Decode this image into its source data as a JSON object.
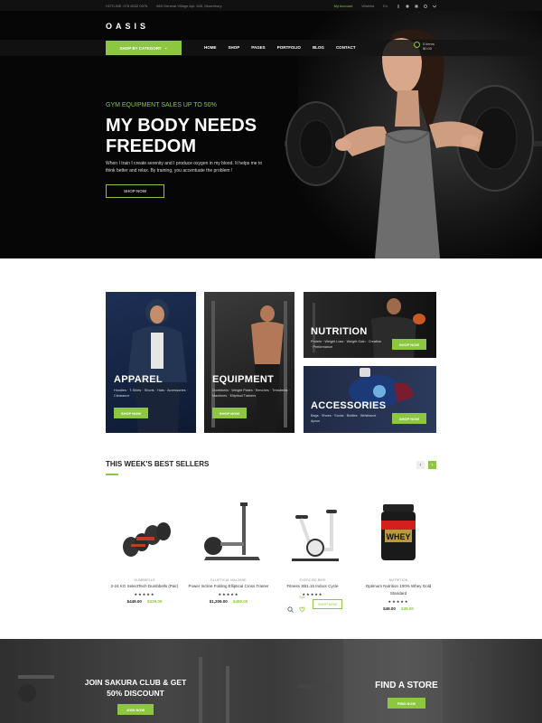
{
  "topbar": {
    "hotline": "HOTLINE: 076 8032 0076",
    "address": "869 General Village Apt. 645, Moorebury",
    "my_account": "My Account",
    "wishlist": "Wishlist",
    "language": "En"
  },
  "brand": {
    "logo": "OASIS"
  },
  "nav": {
    "shop_by_category": "SHOP BY CATEGORY",
    "items": [
      "HOME",
      "SHOP",
      "PAGES",
      "PORTFOLIO",
      "BLOG",
      "CONTACT"
    ],
    "cart_items": "0 items",
    "cart_total": "$0.00"
  },
  "hero": {
    "eyebrow": "GYM EQUIPMENT SALES UP TO 50%",
    "headline": "MY BODY NEEDS FREEDOM",
    "description": "When I train I create serenity and I produce oxygen in my blood. It helps me to think better and relax. By training, you accentuate the problem !",
    "button": "SHOP NOW"
  },
  "categories": [
    {
      "title": "APPAREL",
      "sub": "Hoodies · T-Shirts · Shorts · Hats · Accessories · Clearance",
      "button": "SHOP NOW"
    },
    {
      "title": "EQUIPMENT",
      "sub": "Dumbbells · Weight Plates · Benches · Treadmills · Machines · Elliptical Trainers",
      "button": "SHOP NOW"
    },
    {
      "title": "NUTRITION",
      "sub": "Protein · Weight Loss · Weight Gain · Creatine · Preformance",
      "button": "SHOP NOW"
    },
    {
      "title": "ACCESSORIES",
      "sub": "Bags · Shoes · Socks · Bottles · Wristband · Apron",
      "button": "SHOP NOW"
    }
  ],
  "best_sellers": {
    "title": "THIS WEEK'S BEST SELLERS",
    "prev": "‹",
    "next": "›",
    "products": [
      {
        "category": "DUMBBELLS",
        "name": "2-24 KG SelectTech Dumbbells (Pair)",
        "stars": "★★★★★",
        "price_regular": "$449.00",
        "price_sale": "$329.00"
      },
      {
        "category": "ELLIPTICAL MACHINE",
        "name": "Power Incline Folding Elliptical Cross Trainer",
        "stars": "★★★★★",
        "price_regular": "$1,209.00",
        "price_sale": "$499.00"
      },
      {
        "category": "EXERCISE BIKE",
        "name": "Fitness SB1.15 Indoor Cycle",
        "stars": "★★★★★",
        "badge": "Sale",
        "button": "SHOP NOW"
      },
      {
        "category": "NUTRITION",
        "name": "Optimum Nutrition 100% Whey Gold Standard",
        "stars": "★★★★★",
        "price_regular": "$49.00",
        "price_sale": "$39.00"
      }
    ]
  },
  "promos": {
    "club_title_1": "JOIN SAKURA CLUB & GET",
    "club_title_2": "50% DISCOUNT",
    "club_button": "JOIN NOW",
    "store_title": "FIND A STORE",
    "store_button": "FIND NOW"
  },
  "colors": {
    "accent": "#8dc63f",
    "dark": "#0a0a0a"
  }
}
